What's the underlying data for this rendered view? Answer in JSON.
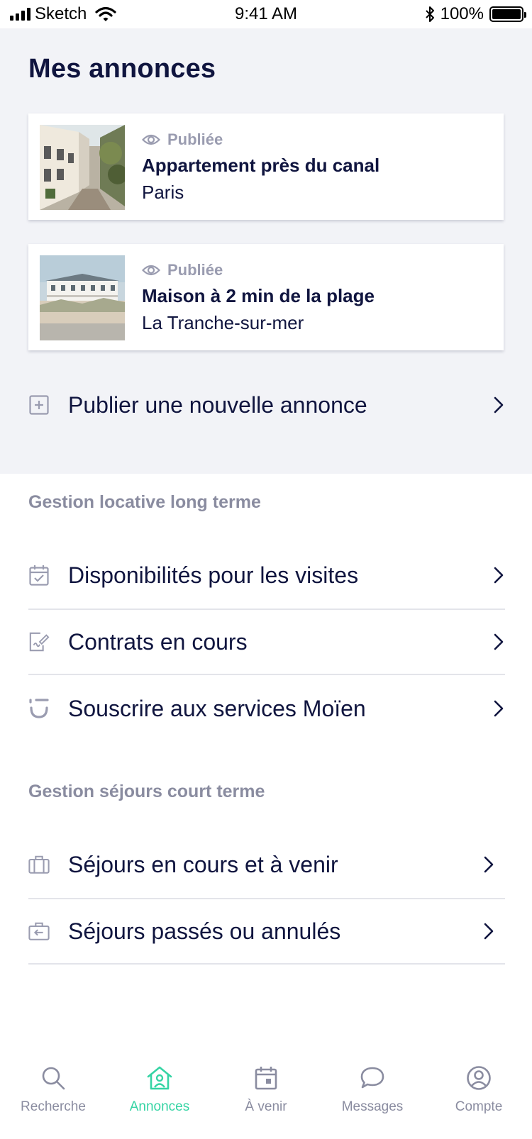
{
  "status_bar": {
    "carrier": "Sketch",
    "time": "9:41 AM",
    "battery": "100%"
  },
  "header": {
    "title": "Mes annonces"
  },
  "listings": [
    {
      "status": "Publiée",
      "title": "Appartement près du canal",
      "city": "Paris"
    },
    {
      "status": "Publiée",
      "title": "Maison à 2 min de la plage",
      "city": "La Tranche-sur-mer"
    }
  ],
  "publish": {
    "label": "Publier une nouvelle annonce"
  },
  "long_term": {
    "heading": "Gestion locative long terme",
    "items": [
      {
        "label": "Disponibilités pour les visites",
        "icon": "calendar-check-icon"
      },
      {
        "label": "Contrats en cours",
        "icon": "contract-sign-icon"
      },
      {
        "label": "Souscrire aux services Moïen",
        "icon": "moien-logo-icon"
      }
    ]
  },
  "short_term": {
    "heading": "Gestion séjours court terme",
    "items": [
      {
        "label": "Séjours en cours et à venir",
        "icon": "suitcase-icon"
      },
      {
        "label": "Séjours passés ou annulés",
        "icon": "suitcase-return-icon"
      }
    ]
  },
  "tab_bar": {
    "active_color": "#35d4a4",
    "inactive_color": "#8a8ca0",
    "tabs": [
      {
        "label": "Recherche",
        "icon": "search-icon",
        "active": false
      },
      {
        "label": "Annonces",
        "icon": "house-user-icon",
        "active": true
      },
      {
        "label": "À venir",
        "icon": "calendar-icon",
        "active": false
      },
      {
        "label": "Messages",
        "icon": "chat-bubble-icon",
        "active": false
      },
      {
        "label": "Compte",
        "icon": "user-circle-icon",
        "active": false
      }
    ]
  }
}
